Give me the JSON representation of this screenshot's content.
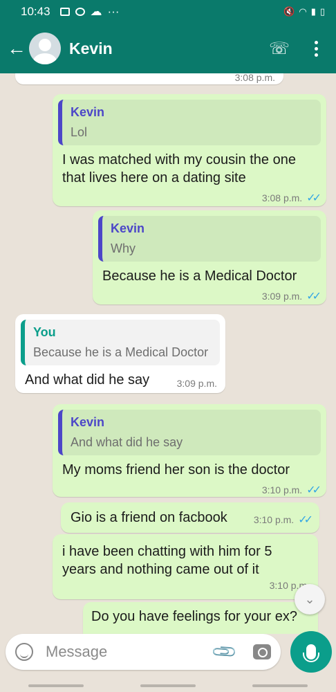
{
  "status_bar": {
    "time": "10:43",
    "icons_left": [
      "image-icon",
      "basketball-icon",
      "cloud-icon",
      "more-icon"
    ],
    "icons_right": [
      "mute-icon",
      "wifi-icon",
      "signal-icon",
      "battery-icon"
    ]
  },
  "header": {
    "contact_name": "Kevin",
    "back_icon": "arrow-left-icon",
    "call_icon": "add-call-icon",
    "menu_icon": "kebab-menu-icon"
  },
  "messages": [
    {
      "direction": "out",
      "time": "3:08 p.m."
    },
    {
      "direction": "out",
      "quote_author": "Kevin",
      "quote_text": "Lol",
      "text": "I was matched with my cousin the one that lives here on a dating site",
      "time": "3:08 p.m.",
      "status": "read"
    },
    {
      "direction": "out",
      "quote_author": "Kevin",
      "quote_text": "Why",
      "text": "Because he is a Medical Doctor",
      "time": "3:09 p.m.",
      "status": "read"
    },
    {
      "direction": "in",
      "quote_author": "You",
      "quote_text": "Because he is a Medical Doctor",
      "text": "And what did he say",
      "time": "3:09 p.m."
    },
    {
      "direction": "out",
      "quote_author": "Kevin",
      "quote_text": "And what did he say",
      "text": "My moms friend her son is the doctor",
      "time": "3:10 p.m.",
      "status": "read"
    },
    {
      "direction": "out",
      "text": "Gio is a friend on facbook",
      "time": "3:10 p.m.",
      "status": "read"
    },
    {
      "direction": "out",
      "text": "i have been chatting with him for 5 years and nothing came out of it",
      "time": "3:10 p.m.",
      "status": "read"
    },
    {
      "direction": "out",
      "text": "Do you have feelings for your ex?"
    }
  ],
  "composer": {
    "placeholder": "Message",
    "emoji_icon": "emoji-icon",
    "attach_icon": "paperclip-icon",
    "camera_icon": "camera-icon",
    "mic_icon": "microphone-icon"
  },
  "colors": {
    "header_bg": "#0a7a6b",
    "outgoing_bubble": "#dcf8c6",
    "incoming_bubble": "#ffffff",
    "accent": "#0b9e8b",
    "quote_author_out": "#4c46c8",
    "read_ticks": "#34a6e5"
  }
}
